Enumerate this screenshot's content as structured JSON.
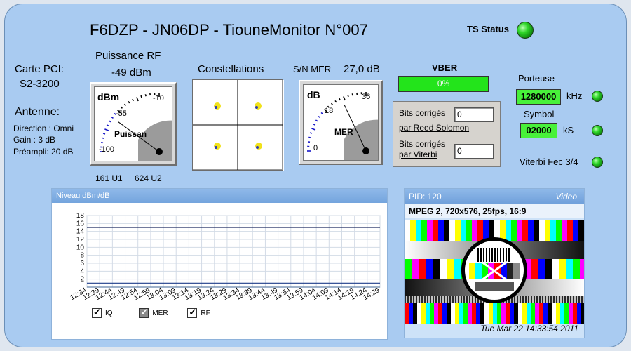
{
  "header": {
    "title": "F6DZP - JN06DP - TiouneMonitor N°007",
    "ts_status_label": "TS Status"
  },
  "card": {
    "label": "Carte PCI:",
    "value": "S2-3200"
  },
  "antenna": {
    "title": "Antenne:",
    "direction": "Direction : Omni",
    "gain": "Gain : 3 dB",
    "preamp": "Préampli: 20 dB"
  },
  "rf_meter": {
    "title": "Puissance RF",
    "value": "-49 dBm",
    "unit": "dBm",
    "ticks": [
      "-10",
      "-55",
      "-100"
    ],
    "caption": "Puissan",
    "u1": "161 U1",
    "u2": "624 U2",
    "needle_fraction": 0.4
  },
  "constellation": {
    "title": "Constellations"
  },
  "mer_meter": {
    "title": "S/N MER",
    "value": "27,0 dB",
    "unit": "dB",
    "ticks": [
      "36",
      "18",
      "0"
    ],
    "caption": "MER",
    "needle_fraction": 0.72
  },
  "vber": {
    "title": "VBER",
    "value": "0%"
  },
  "bits": {
    "rs_label_1": "Bits corrigés",
    "rs_label_2": "par Reed Solomon",
    "rs_value": "0",
    "viterbi_label_1": "Bits corrigés",
    "viterbi_label_2": "par Viterbi",
    "viterbi_value": "0"
  },
  "carrier": {
    "label": "Porteuse",
    "value": "1280000",
    "unit": "kHz"
  },
  "symbol": {
    "label": "Symbol",
    "value": "02000",
    "unit": "kS"
  },
  "viterbi_fec": {
    "label": "Viterbi Fec 3/4"
  },
  "level_chart": {
    "window_title": "Niveau dBm/dB",
    "legend": [
      {
        "label": "IQ",
        "checked": true
      },
      {
        "label": "MER",
        "checked": true
      },
      {
        "label": "RF",
        "checked": true
      }
    ]
  },
  "chart_data": {
    "type": "line",
    "title": "",
    "xlabel": "",
    "ylabel": "",
    "ylim": [
      0,
      18
    ],
    "yticks": [
      2,
      4,
      6,
      8,
      10,
      12,
      14,
      16,
      18
    ],
    "x": [
      "12:34",
      "12:39",
      "12:44",
      "12:49",
      "12:54",
      "12:59",
      "13:04",
      "13:09",
      "13:14",
      "13:19",
      "13:24",
      "13:29",
      "13:34",
      "13:39",
      "13:44",
      "13:49",
      "13:54",
      "13:59",
      "14:04",
      "14:09",
      "14:14",
      "14:19",
      "14:24",
      "14:29"
    ],
    "series": [
      {
        "name": "IQ",
        "color": "#1d2a60",
        "values": [
          15,
          15,
          15,
          15,
          15,
          15,
          15,
          15,
          15,
          15,
          15,
          15,
          15,
          15,
          15,
          15,
          15,
          15,
          15,
          15,
          15,
          15,
          15,
          15
        ]
      },
      {
        "name": "MER",
        "color": "#1e3d8a",
        "values": [
          1,
          1,
          1,
          1,
          1,
          1,
          1,
          1,
          1,
          1,
          1,
          1,
          1,
          1,
          1,
          1,
          1,
          1,
          1,
          1,
          1,
          1,
          1,
          1
        ]
      },
      {
        "name": "RF",
        "color": "#4a79b4",
        "values": [
          0,
          0,
          0,
          0,
          0,
          0,
          0,
          0,
          0,
          0,
          0,
          0,
          0,
          0,
          0,
          0,
          0,
          0,
          0,
          0,
          0,
          0,
          0,
          0
        ]
      }
    ]
  },
  "video": {
    "pid": "PID: 120",
    "type": "Video",
    "format": "MPEG 2, 720x576, 25fps, 16:9",
    "timestamp": "Tue Mar 22 14:33:54 2011"
  }
}
